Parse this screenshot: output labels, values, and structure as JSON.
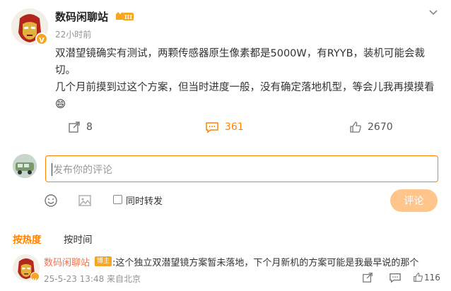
{
  "post": {
    "username": "数码闲聊站",
    "level_badge": "III",
    "timestamp": "22小时前",
    "text_line1": "双潜望镜确实有测试，两颗传感器原生像素都是5000W，有RYYB，装机可能会裁切。",
    "text_line2": "几个月前摸到过这个方案，但当时进度一般，没有确定落地机型，等会儿我再摸摸看",
    "emoji": "😄"
  },
  "stats": {
    "reposts": "8",
    "comments": "361",
    "likes": "2670"
  },
  "comment_box": {
    "placeholder": "发布你的评论",
    "repost_label": "同时转发",
    "submit_label": "评论"
  },
  "sort_tabs": {
    "hot": "按热度",
    "time": "按时间"
  },
  "top_comment": {
    "username": "数码闲聊站",
    "badge": "博主",
    "text": ":这个独立双潜望镜方案暂未落地，下个月新机的方案可能是我最早说的那个",
    "meta": "25-5-23 13:48 来自北京",
    "likes": "116"
  },
  "colors": {
    "accent": "#ff8200",
    "submit_disabled": "#ffc58a",
    "username_link": "#eb7350",
    "verified": "#f6a623"
  },
  "icons": [
    "ironman-avatar",
    "verified-icon",
    "level-badge-icon",
    "chevron-down-icon",
    "repost-icon",
    "comment-icon",
    "like-icon",
    "van-avatar",
    "emoji-icon",
    "image-icon",
    "share-icon",
    "reply-icon"
  ]
}
